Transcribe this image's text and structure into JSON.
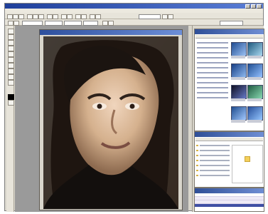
{
  "window": {
    "title": "",
    "minimize_label": "",
    "maximize_label": "",
    "close_label": ""
  },
  "menubar": {
    "items": [
      "",
      "",
      "",
      "",
      "",
      "",
      "",
      ""
    ]
  },
  "toolbar": {
    "zoom_value": "",
    "search_value": ""
  },
  "document": {
    "title": ""
  },
  "panels": {
    "browser_title": "",
    "preview_title": "",
    "info_title": ""
  }
}
